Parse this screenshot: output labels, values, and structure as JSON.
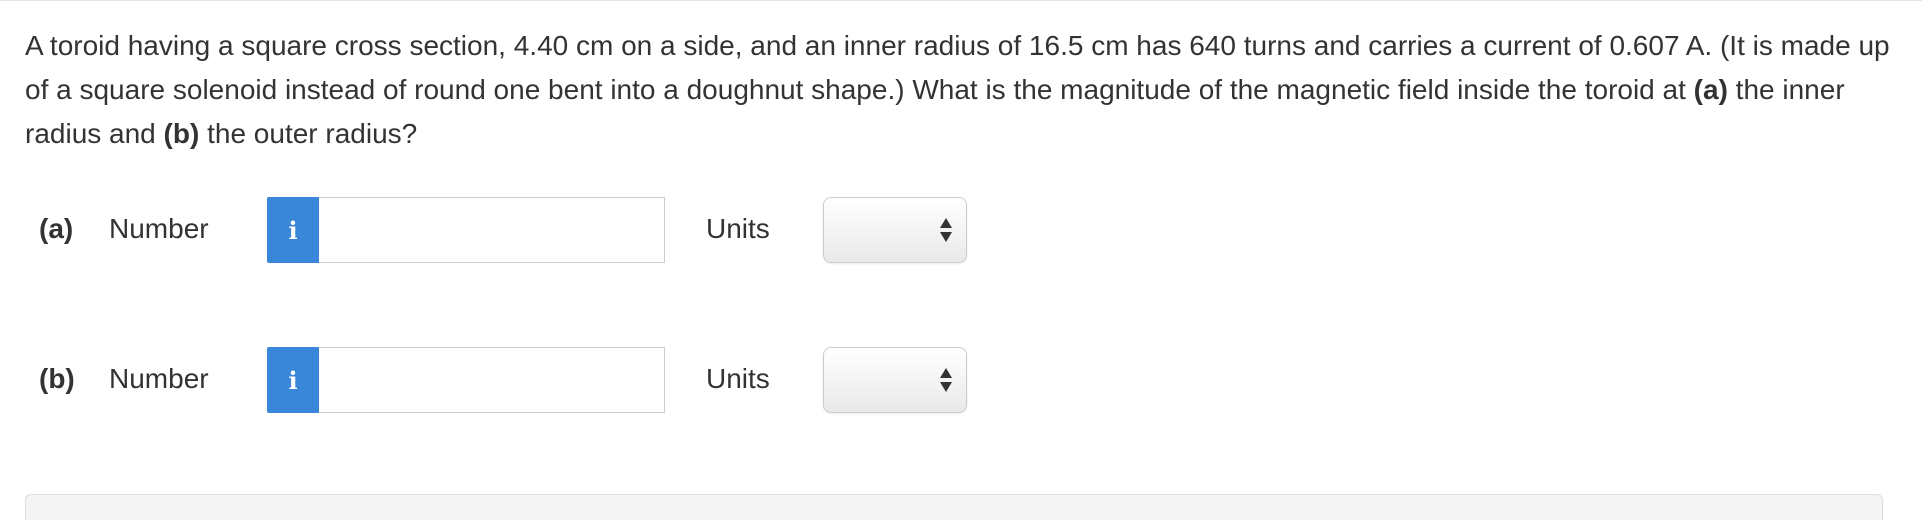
{
  "question": {
    "text_1": "A toroid having a square cross section, 4.40 cm on a side, and an inner radius of 16.5 cm has 640 turns and carries a current of 0.607 A. (It is made up of a square solenoid instead of round one bent into a doughnut shape.) What is the magnitude of the magnetic field inside the toroid at ",
    "part_a_ref": "(a)",
    "text_2": " the inner radius and ",
    "part_b_ref": "(b)",
    "text_3": " the outer radius?"
  },
  "answers": [
    {
      "part_label": "(a)",
      "number_label": "Number",
      "info_icon": "i",
      "number_value": "",
      "units_label": "Units",
      "units_selected": ""
    },
    {
      "part_label": "(b)",
      "number_label": "Number",
      "info_icon": "i",
      "number_value": "",
      "units_label": "Units",
      "units_selected": ""
    }
  ],
  "colors": {
    "info_button": "#3a86d8",
    "text": "#333333"
  }
}
